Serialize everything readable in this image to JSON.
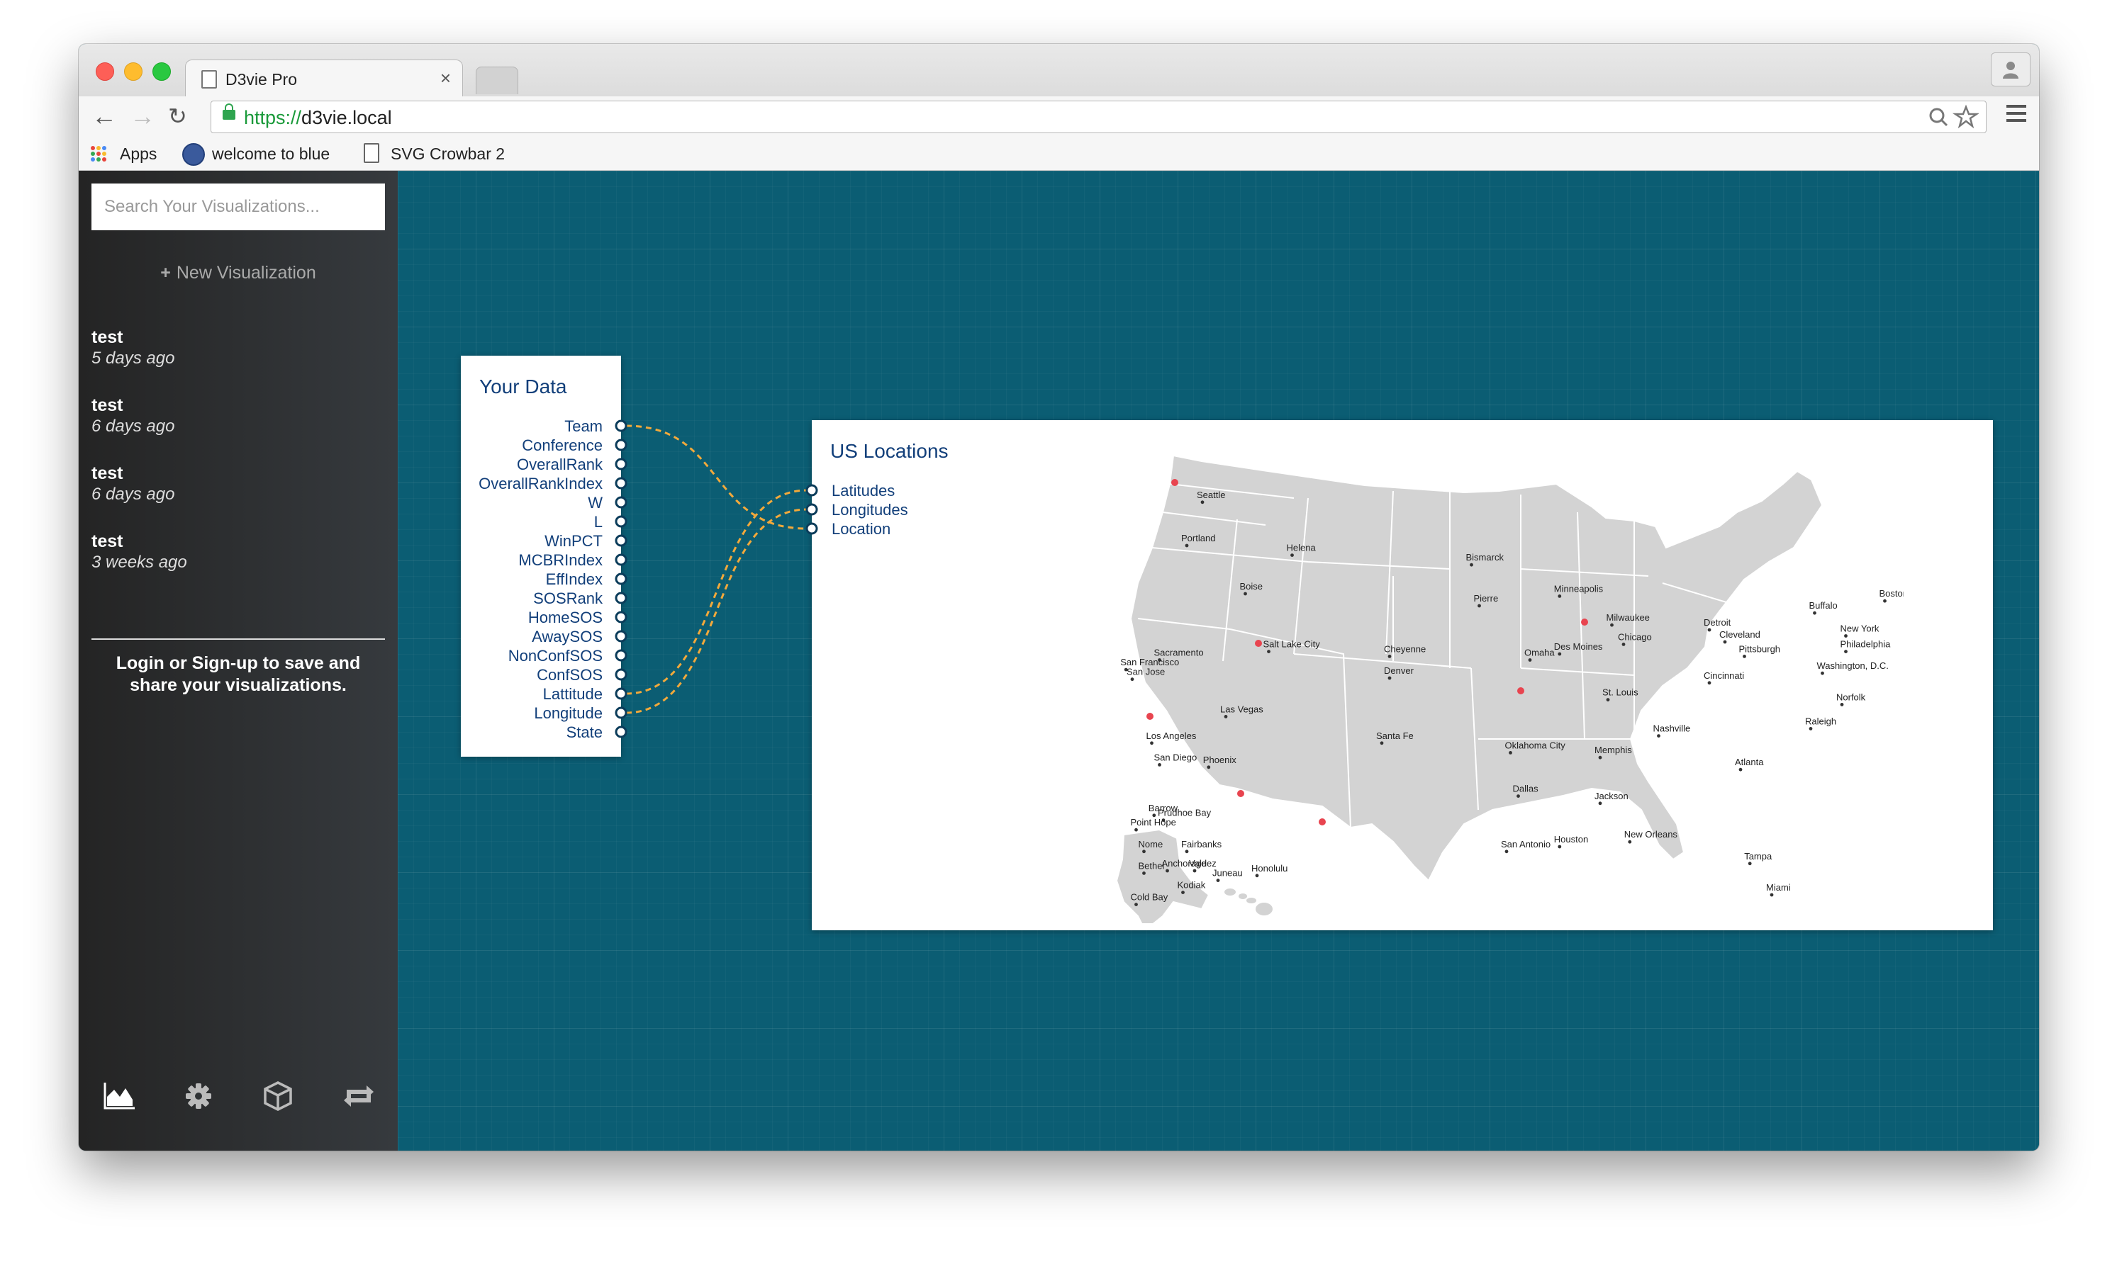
{
  "browser": {
    "tab_title": "D3vie Pro",
    "tab_close": "×",
    "url_scheme": "https://",
    "url_host": "d3vie.local",
    "bookmarks": [
      "Apps",
      "welcome to blue",
      "SVG Crowbar 2"
    ]
  },
  "sidebar": {
    "search_placeholder": "Search Your Visualizations...",
    "new_viz_label": "New Visualization",
    "history": [
      {
        "name": "test",
        "time": "5 days ago"
      },
      {
        "name": "test",
        "time": "6 days ago"
      },
      {
        "name": "test",
        "time": "6 days ago"
      },
      {
        "name": "test",
        "time": "3 weeks ago"
      }
    ],
    "login_text": "Login or Sign-up to save and share your visualizations.",
    "bottom_icons": [
      "area-chart-icon",
      "gear-icon",
      "cube-icon",
      "retweet-icon"
    ]
  },
  "data_node": {
    "title": "Your Data",
    "fields": [
      "Team",
      "Conference",
      "OverallRank",
      "OverallRankIndex",
      "W",
      "L",
      "WinPCT",
      "MCBRIndex",
      "EffIndex",
      "SOSRank",
      "HomeSOS",
      "AwaySOS",
      "NonConfSOS",
      "ConfSOS",
      "Lattitude",
      "Longitude",
      "State"
    ]
  },
  "viz_node": {
    "title": "US Locations",
    "inputs": [
      "Latitudes",
      "Longitudes",
      "Location"
    ]
  },
  "connections": [
    {
      "from": "Team",
      "to": "Location"
    },
    {
      "from": "Lattitude",
      "to": "Latitudes"
    },
    {
      "from": "Longitude",
      "to": "Longitudes"
    }
  ],
  "map_cities": [
    "Seattle",
    "Portland",
    "Helena",
    "Bismarck",
    "Boise",
    "Pierre",
    "Minneapolis",
    "Boston",
    "Buffalo",
    "Milwaukee",
    "Detroit",
    "Cleveland",
    "New York",
    "Chicago",
    "Philadelphia",
    "Pittsburgh",
    "Washington, D.C.",
    "Sacramento",
    "San Francisco",
    "San Jose",
    "Salt Lake City",
    "Cheyenne",
    "Omaha",
    "Des Moines",
    "Denver",
    "Cincinnati",
    "St. Louis",
    "Norfolk",
    "Las Vegas",
    "Raleigh",
    "Nashville",
    "Los Angeles",
    "Santa Fe",
    "Oklahoma City",
    "Memphis",
    "San Diego",
    "Phoenix",
    "Atlanta",
    "Dallas",
    "Jackson",
    "Barrow",
    "Prudhoe Bay",
    "Point Hope",
    "Nome",
    "Fairbanks",
    "Bethel",
    "Anchorage",
    "Valdez",
    "Juneau",
    "Honolulu",
    "Kodiak",
    "Cold Bay",
    "San Antonio",
    "Houston",
    "New Orleans",
    "Tampa",
    "Miami"
  ],
  "colors": {
    "canvas": "#0b5d73",
    "sidebar": "#2b2d30",
    "node_text": "#123f7a",
    "wire": "#f2a93b",
    "map_fill": "#d3d3d3",
    "marker": "#e8444f"
  }
}
